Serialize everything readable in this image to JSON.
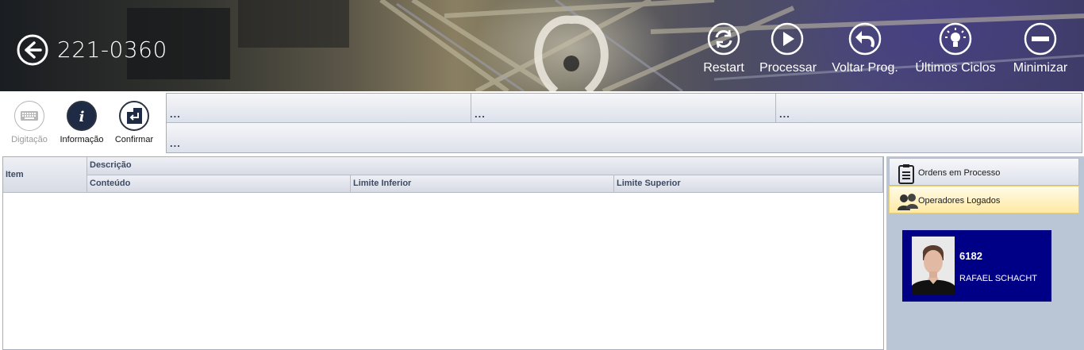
{
  "header": {
    "title": "221-0360",
    "buttons": [
      {
        "id": "restart",
        "label": "Restart",
        "icon": "restart-icon"
      },
      {
        "id": "processar",
        "label": "Processar",
        "icon": "play-icon"
      },
      {
        "id": "voltar",
        "label": "Voltar Prog.",
        "icon": "undo-icon"
      },
      {
        "id": "ultimos",
        "label": "Últimos Ciclos",
        "icon": "lightbulb-icon"
      },
      {
        "id": "minimizar",
        "label": "Minimizar",
        "icon": "minimize-icon"
      }
    ]
  },
  "toolbar": {
    "digitacao": {
      "label": "Digitação",
      "icon": "keyboard-icon",
      "enabled": false
    },
    "informacao": {
      "label": "Informação",
      "icon": "info-icon"
    },
    "confirmar": {
      "label": "Confirmar",
      "icon": "enter-icon"
    },
    "fields": [
      "...",
      "...",
      "...",
      "..."
    ]
  },
  "grid": {
    "columns": {
      "item": "Item",
      "descricao": "Descrição",
      "conteudo": "Conteúdo",
      "limite_inferior": "Limite Inferior",
      "limite_superior": "Limite Superior"
    },
    "rows": []
  },
  "side_panel": {
    "tabs": [
      {
        "label": "Ordens em Processo",
        "icon": "clipboard-icon",
        "active": false
      },
      {
        "label": "Operadores Logados",
        "icon": "users-icon",
        "active": true
      }
    ],
    "operators": [
      {
        "code": "6182",
        "name": "RAFAEL SCHACHT"
      }
    ],
    "colors": {
      "card_bg": "#000087",
      "panel_bg": "#bac6d6",
      "active_tab": "#ffe9a3"
    }
  }
}
